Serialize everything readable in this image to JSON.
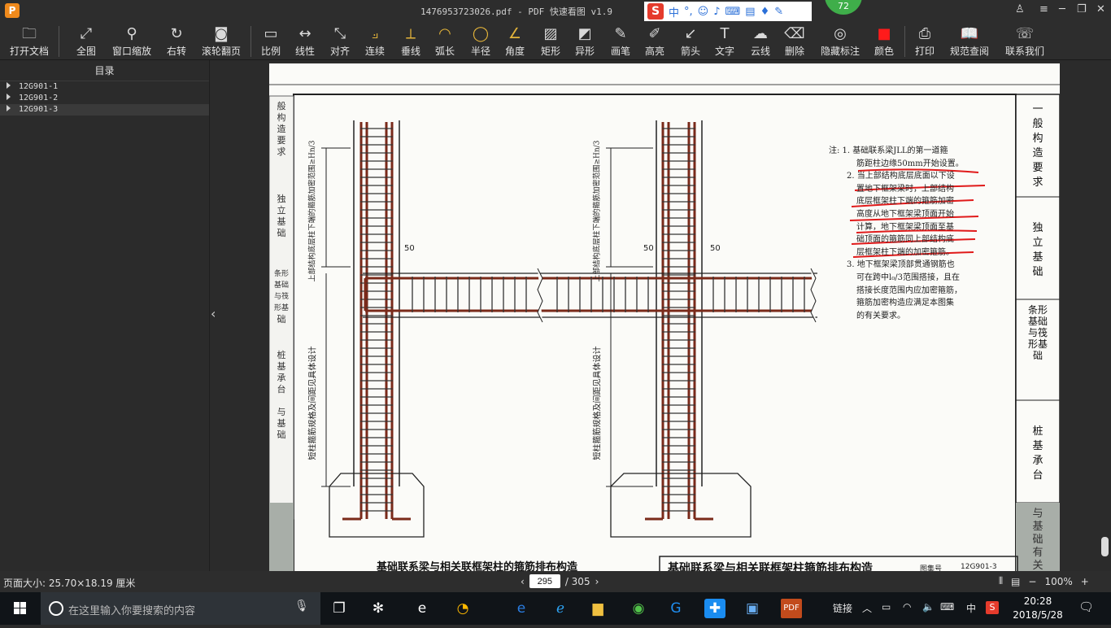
{
  "window": {
    "title": "1476953723026.pdf - PDF 快速看图 v1.9",
    "ime_label": "中",
    "badge": "72"
  },
  "toolbar": {
    "tools": [
      {
        "label": "打开文档",
        "icon": "folder-icon"
      },
      {
        "label": "全图",
        "icon": "fit-icon"
      },
      {
        "label": "窗口缩放",
        "icon": "zoom-icon"
      },
      {
        "label": "右转",
        "icon": "rotate-icon"
      },
      {
        "label": "滚轮翻页",
        "icon": "mouse-icon"
      },
      {
        "label": "比例",
        "icon": "scale-icon"
      },
      {
        "label": "线性",
        "icon": "linear-icon"
      },
      {
        "label": "对齐",
        "icon": "align-icon"
      },
      {
        "label": "连续",
        "icon": "continuous-icon"
      },
      {
        "label": "垂线",
        "icon": "perpendicular-icon"
      },
      {
        "label": "弧长",
        "icon": "arc-icon"
      },
      {
        "label": "半径",
        "icon": "radius-icon"
      },
      {
        "label": "角度",
        "icon": "angle-icon"
      },
      {
        "label": "矩形",
        "icon": "rectangle-icon"
      },
      {
        "label": "异形",
        "icon": "polygon-icon"
      },
      {
        "label": "画笔",
        "icon": "pen-icon"
      },
      {
        "label": "高亮",
        "icon": "highlight-icon"
      },
      {
        "label": "箭头",
        "icon": "arrow-icon"
      },
      {
        "label": "文字",
        "icon": "text-icon"
      },
      {
        "label": "云线",
        "icon": "cloud-icon"
      },
      {
        "label": "删除",
        "icon": "eraser-icon"
      },
      {
        "label": "隐藏标注",
        "icon": "eye-hide-icon"
      },
      {
        "label": "颜色",
        "icon": "color-icon"
      },
      {
        "label": "打印",
        "icon": "print-icon"
      },
      {
        "label": "规范查阅",
        "icon": "book-icon"
      },
      {
        "label": "联系我们",
        "icon": "contact-icon"
      }
    ]
  },
  "sidebar": {
    "title": "目录",
    "items": [
      "12G901-1",
      "12G901-2",
      "12G901-3"
    ]
  },
  "document": {
    "side_tabs": [
      "一般构造要求",
      "独立基础",
      "条形基础与筏形基础",
      "桩基承台",
      "与基础有关构造"
    ],
    "left_strip": [
      "般",
      "构",
      "造",
      "要",
      "求",
      "独",
      "立",
      "基",
      "础",
      "条形",
      "基础",
      "与筏",
      "形基",
      "础",
      "桩",
      "基",
      "承",
      "台",
      "与",
      "基",
      "础"
    ],
    "notes": [
      "注: 1. 基础联系梁JLL的第一道箍",
      "筋距柱边缘50mm开始设置。",
      "2. 当上部结构底层底面以下设",
      "置地下框架梁时，上部结构",
      "底层框架柱下端的箍筋加密",
      "高度从地下框架梁顶面开始",
      "计算，地下框架梁顶面至基",
      "础顶面的箍筋同上部结构底",
      "层框架柱下端的加密箍筋。",
      "3. 地下框架梁顶部贯通钢筋也",
      "可在跨中l₀/3范围搭接，且在",
      "搭接长度范围内应加密箍筋，",
      "箍筋加密构造应满足本图集",
      "的有关要求。"
    ],
    "dim_upper": "上部结构底层柱下端的箍筋加密范围≥Hn/3",
    "dim_lower": "短柱箍筋规格及间距见具体设计",
    "dim_50": "50",
    "bottom_title": "基础联系梁与相关联框架柱的箍筋排布构造",
    "title_block": "基础联系梁与相关联框架柱箍筋排布构造",
    "title_block_label": "图集号",
    "title_block_no": "12G901-3"
  },
  "status": {
    "page_size": "页面大小: 25.70×18.19 厘米",
    "current_page": "295",
    "total_pages": "/ 305",
    "zoom": "100%"
  },
  "taskbar": {
    "search_placeholder": "在这里输入你要搜索的内容",
    "link_label": "链接",
    "lang": "中",
    "time": "20:28",
    "date": "2018/5/28"
  }
}
